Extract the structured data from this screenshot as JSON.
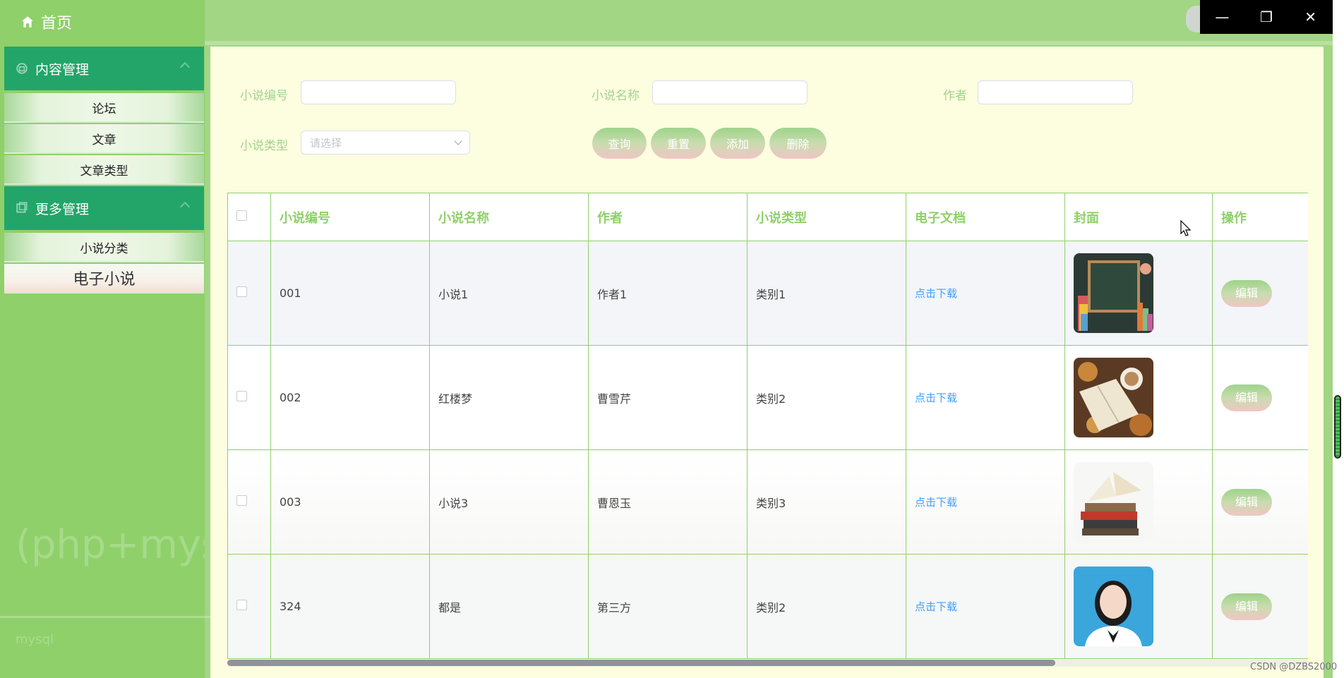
{
  "sidebar": {
    "home_label": "首页",
    "groups": [
      {
        "label": "内容管理",
        "items": [
          "论坛",
          "文章",
          "文章类型"
        ]
      },
      {
        "label": "更多管理",
        "items": [
          "小说分类",
          "电子小说"
        ]
      }
    ],
    "active_item": "电子小说",
    "overlay_text": "(php+mysql",
    "overlay_small": "mysql"
  },
  "window_controls": {
    "minimize": "—",
    "restore": "❐",
    "close": "✕"
  },
  "search": {
    "novel_id_label": "小说编号",
    "novel_name_label": "小说名称",
    "author_label": "作者",
    "novel_type_label": "小说类型",
    "novel_type_placeholder": "请选择",
    "novel_id_value": "",
    "novel_name_value": "",
    "author_value": ""
  },
  "buttons": {
    "query": "查询",
    "reset": "重置",
    "add": "添加",
    "delete": "删除"
  },
  "table": {
    "headers": [
      "小说编号",
      "小说名称",
      "作者",
      "小说类型",
      "电子文档",
      "封面",
      "操作"
    ],
    "rows": [
      {
        "id": "001",
        "name": "小说1",
        "author": "作者1",
        "type": "类别1",
        "doc": "点击下载",
        "cover": "chalkboard-books",
        "action": "编辑"
      },
      {
        "id": "002",
        "name": "红楼梦",
        "author": "曹雪芹",
        "type": "类别2",
        "doc": "点击下载",
        "cover": "book-coffee-leaves",
        "action": "编辑"
      },
      {
        "id": "003",
        "name": "小说3",
        "author": "曹恩玉",
        "type": "类别3",
        "doc": "点击下载",
        "cover": "book-stack",
        "action": "编辑"
      },
      {
        "id": "324",
        "name": "都是",
        "author": "第三方",
        "type": "类别2",
        "doc": "点击下载",
        "cover": "portrait-photo",
        "action": "编辑"
      }
    ]
  },
  "watermark": "CSDN @DZBS2000",
  "colors": {
    "sidebar_bg": "#8fd06a",
    "group_bg": "#23a56a",
    "main_bg": "#fdfde0",
    "table_border": "#8fd06a",
    "link": "#409eff"
  }
}
